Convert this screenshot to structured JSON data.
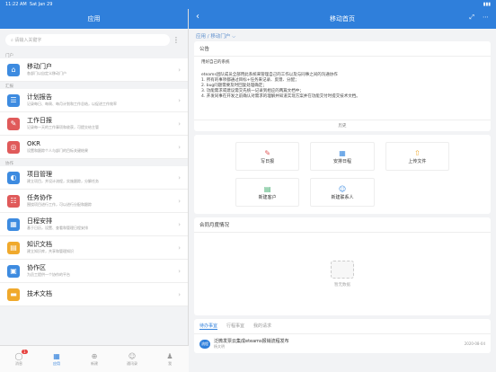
{
  "status": {
    "time": "11:22 AM",
    "date": "Sat Jan 29"
  },
  "left": {
    "title": "应用",
    "search_placeholder": "请输入关键字",
    "more": "⋮",
    "sections": {
      "s1": "门户",
      "s2": "汇报",
      "s3": "协作"
    },
    "items": [
      {
        "title": "移动门户",
        "sub": "各部门以自定义移动门户",
        "color": "#3d8be0",
        "icon": "⌂"
      },
      {
        "title": "计划报告",
        "sub": "记录每日、每周、每月计划和工作总结，以促进工作效率",
        "color": "#3d8be0",
        "icon": "☰"
      },
      {
        "title": "工作日报",
        "sub": "记录每一天的工作事项和收获，可提交给主管",
        "color": "#e05a5a",
        "icon": "✎"
      },
      {
        "title": "OKR",
        "sub": "设置和跟踪个人与部门的目标关键结果",
        "color": "#e05a5a",
        "icon": "◎"
      },
      {
        "title": "项目管理",
        "sub": "建立项目，并设计流程，实施跟踪，分解任务",
        "color": "#3d8be0",
        "icon": "◐"
      },
      {
        "title": "任务协作",
        "sub": "围绕项目进行工作，可以进行分配和跟踪",
        "color": "#e05a5a",
        "icon": "☷"
      },
      {
        "title": "日程安排",
        "sub": "基于日历，设置、查看和管理日程安排",
        "color": "#3d8be0",
        "icon": "▦"
      },
      {
        "title": "知识文档",
        "sub": "建立知识库，共享和管理知识",
        "color": "#f0a92c",
        "icon": "▤"
      },
      {
        "title": "协作区",
        "sub": "为员工提供一个协作的平台",
        "color": "#3d8be0",
        "icon": "▣"
      },
      {
        "title": "技术文档",
        "sub": "",
        "color": "#f0a92c",
        "icon": "▬"
      }
    ],
    "tabs": [
      {
        "label": "消息",
        "icon": "◯",
        "badge": "1"
      },
      {
        "label": "应用",
        "icon": "▦"
      },
      {
        "label": "新建",
        "icon": "⊕"
      },
      {
        "label": "通讯录",
        "icon": "☺"
      },
      {
        "label": "我",
        "icon": "♟"
      }
    ]
  },
  "right": {
    "title": "移动首页",
    "back": "‹",
    "actions": [
      "⤢",
      "⋯"
    ],
    "breadcrumb": "应用 / 移动门户 ⌵",
    "notice": {
      "title": "公告",
      "heading": "用好自己的系统",
      "lines": [
        "eteams团队成员全部用此系统来管理自己的工作以及与同事之间的沟通协作",
        "1. 所有的事项都通过目标+任务来记录、反馈、分配；",
        "2. bug问题需要及时回复处理确定；",
        "3. 功能需求或建议需交先统一记录到相应的两篇文档中；",
        "4. 开发同事在开发之前确认对需求的理解并知道实现方案并在功能交付时提交技术文档。"
      ],
      "history": "历史"
    },
    "quick": [
      {
        "label": "写日报",
        "icon": "✎",
        "color": "#e05a5a"
      },
      {
        "label": "安排日程",
        "icon": "▦",
        "color": "#3d8be0"
      },
      {
        "label": "上传文件",
        "icon": "⇧",
        "color": "#f0a92c"
      },
      {
        "label": "新建客户",
        "icon": "▤",
        "color": "#3dab6b"
      },
      {
        "label": "新建联系人",
        "icon": "☺",
        "color": "#3d8be0"
      }
    ],
    "contract": {
      "title": "合同月度情况",
      "empty": "暂无数据"
    },
    "todo": {
      "tabs": [
        "待办事宜",
        "行程事宜",
        "我的请求"
      ],
      "item": {
        "tag": "流程",
        "title": "泛微发票云集成eteams报销流程发布",
        "user": "杨文明",
        "date": "2020-08-04"
      }
    }
  }
}
